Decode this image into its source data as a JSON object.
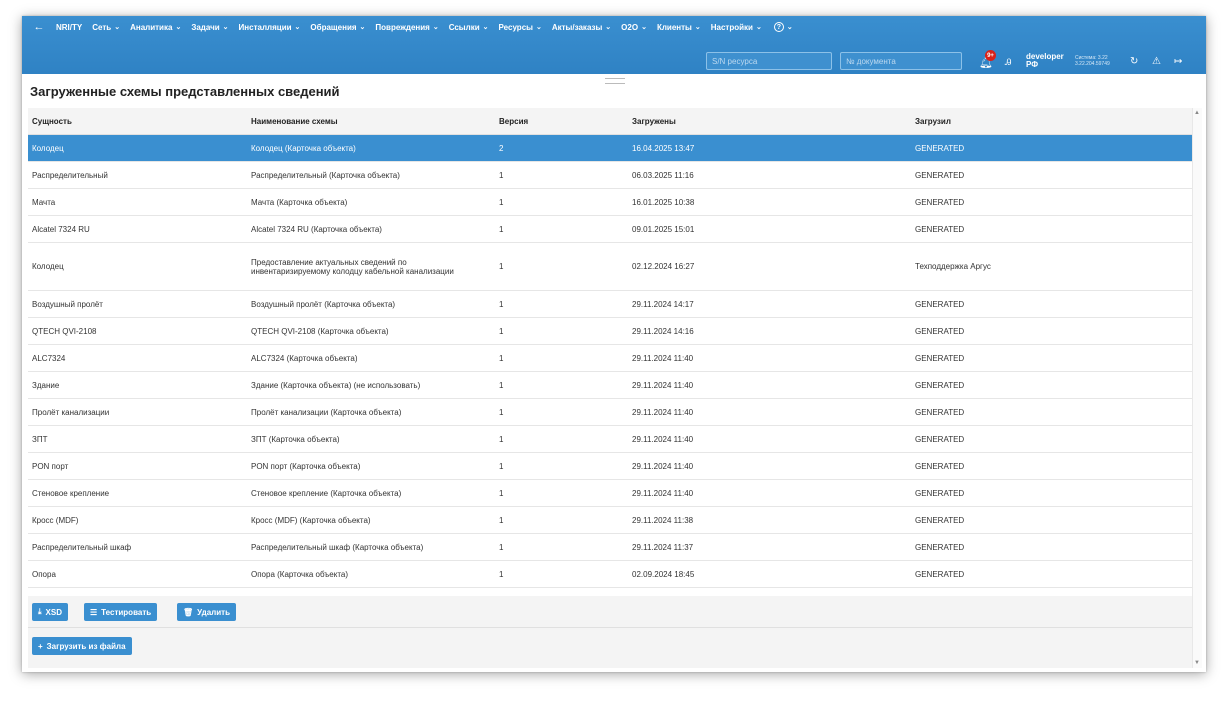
{
  "nav": {
    "back": "←",
    "items": [
      {
        "label": "NRI/TY",
        "caret": ""
      },
      {
        "label": "Сеть",
        "caret": "⌄"
      },
      {
        "label": "Аналитика",
        "caret": "⌄"
      },
      {
        "label": "Задачи",
        "caret": "⌄"
      },
      {
        "label": "Инсталляции",
        "caret": "⌄"
      },
      {
        "label": "Обращения",
        "caret": "⌄"
      },
      {
        "label": "Повреждения",
        "caret": "⌄"
      },
      {
        "label": "Ссылки",
        "caret": "⌄"
      },
      {
        "label": "Ресурсы",
        "caret": "⌄"
      },
      {
        "label": "Акты/заказы",
        "caret": "⌄"
      },
      {
        "label": "O2O",
        "caret": "⌄"
      },
      {
        "label": "Клиенты",
        "caret": "⌄"
      },
      {
        "label": "Настройки",
        "caret": "⌄"
      }
    ],
    "help": "?",
    "help_caret": "⌄"
  },
  "search": {
    "sn_placeholder": "S/N ресурса",
    "doc_placeholder": "№ документа"
  },
  "header": {
    "notif_badge": "9+",
    "user_line1": "developer",
    "user_line2": "РФ",
    "sys_line1": "Система: 3.22",
    "sys_line2": "3.22.204.59749"
  },
  "page": {
    "title": "Загруженные схемы представленных сведений"
  },
  "table": {
    "headers": [
      "Сущность",
      "Наименование схемы",
      "Версия",
      "Загружены",
      "Загрузил"
    ],
    "rows": [
      [
        "Колодец",
        "Колодец (Карточка объекта)",
        "2",
        "16.04.2025 13:47",
        "GENERATED"
      ],
      [
        "Распределительный",
        "Распределительный (Карточка объекта)",
        "1",
        "06.03.2025 11:16",
        "GENERATED"
      ],
      [
        "Мачта",
        "Мачта (Карточка объекта)",
        "1",
        "16.01.2025 10:38",
        "GENERATED"
      ],
      [
        "Alcatel 7324 RU",
        "Alcatel 7324 RU (Карточка объекта)",
        "1",
        "09.01.2025 15:01",
        "GENERATED"
      ],
      [
        "Колодец",
        "Предоставление актуальных сведений по инвентаризируемому колодцу кабельной канализации",
        "1",
        "02.12.2024 16:27",
        "Техподдержка Аргус"
      ],
      [
        "Воздушный пролёт",
        "Воздушный пролёт (Карточка объекта)",
        "1",
        "29.11.2024 14:17",
        "GENERATED"
      ],
      [
        "QTECH QVI-2108",
        "QTECH QVI-2108 (Карточка объекта)",
        "1",
        "29.11.2024 14:16",
        "GENERATED"
      ],
      [
        "ALC7324",
        "ALC7324 (Карточка объекта)",
        "1",
        "29.11.2024 11:40",
        "GENERATED"
      ],
      [
        "Здание",
        "Здание (Карточка объекта) (не использовать)",
        "1",
        "29.11.2024 11:40",
        "GENERATED"
      ],
      [
        "Пролёт канализации",
        "Пролёт канализации (Карточка объекта)",
        "1",
        "29.11.2024 11:40",
        "GENERATED"
      ],
      [
        "ЗПТ",
        "ЗПТ (Карточка объекта)",
        "1",
        "29.11.2024 11:40",
        "GENERATED"
      ],
      [
        "PON порт",
        "PON порт (Карточка объекта)",
        "1",
        "29.11.2024 11:40",
        "GENERATED"
      ],
      [
        "Стеновое крепление",
        "Стеновое крепление (Карточка объекта)",
        "1",
        "29.11.2024 11:40",
        "GENERATED"
      ],
      [
        "Кросс (MDF)",
        "Кросс (MDF) (Карточка объекта)",
        "1",
        "29.11.2024 11:38",
        "GENERATED"
      ],
      [
        "Распределительный шкаф",
        "Распределительный шкаф (Карточка объекта)",
        "1",
        "29.11.2024 11:37",
        "GENERATED"
      ],
      [
        "Опора",
        "Опора (Карточка объекта)",
        "1",
        "02.09.2024 18:45",
        "GENERATED"
      ]
    ],
    "selected_index": 0
  },
  "actions": {
    "xsd_label": "XSD",
    "test_label": "Тестировать",
    "delete_label": "Удалить",
    "upload_label": "Загрузить из файла"
  },
  "colors": {
    "accent": "#3a8fd0",
    "badge": "#d9221a"
  }
}
